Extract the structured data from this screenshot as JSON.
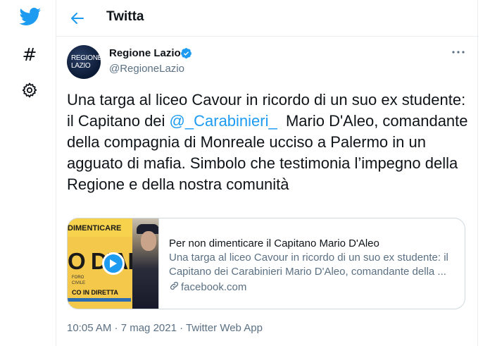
{
  "nav": {
    "icons": [
      "twitter-bird-icon",
      "hashtag-icon",
      "settings-gear-icon"
    ],
    "hashtag_glyph": "#"
  },
  "header": {
    "title": "Twitta",
    "back_icon": "arrow-left-icon"
  },
  "tweet": {
    "author_name": "Regione Lazio",
    "author_handle": "@RegioneLazio",
    "avatar_text_line1": "REGIONE",
    "avatar_text_line2": "LAZIO",
    "text_part1": "Una targa al liceo Cavour in ricordo di un suo ex studente: il Capitano dei ",
    "mention": "@_Carabinieri_",
    "text_part2": "  Mario D'Aleo, comandante della compagnia di Monreale ucciso a Palermo in un agguato di mafia. Simbolo che testimonia l’impegno della Regione e della nostra comunità",
    "timestamp": "10:05 AM · 7 mag 2021 · Twitter Web App"
  },
  "card": {
    "title": "Per non dimenticare il Capitano Mario D'Aleo",
    "description": "Una targa al liceo Cavour in ricordo di un suo ex studente: il Capitano dei Carabinieri Mario D'Aleo, comandante della ...",
    "domain": "facebook.com",
    "thumb_top": "DIMENTICARE",
    "thumb_name": "O D'ALE",
    "thumb_small_1": "FORO",
    "thumb_small_2": "CIVILE",
    "thumb_live": "CO IN DIRETTA"
  },
  "colors": {
    "accent": "#1d9bf0",
    "secondary_text": "#5b7083",
    "border": "#cfd9de"
  }
}
